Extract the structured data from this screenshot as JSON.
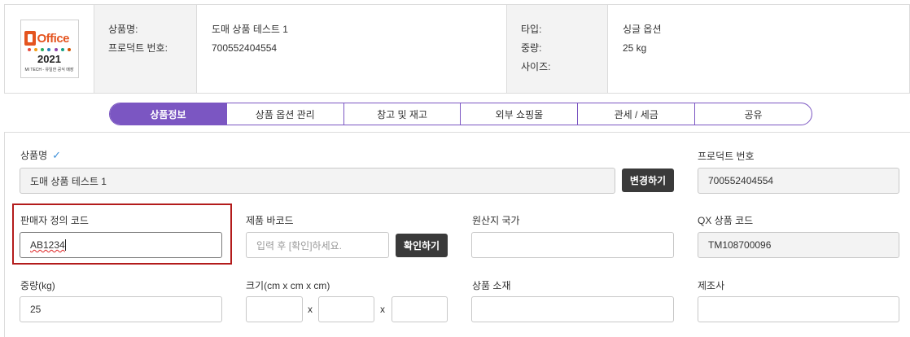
{
  "product_image": {
    "brand": "Office",
    "year": "2021",
    "caption": "MI TECH - 유일한 공식 매장",
    "dot_colors": [
      "#e74c3c",
      "#f39c12",
      "#27ae60",
      "#2980b9",
      "#8e44ad",
      "#16a085",
      "#d35400"
    ]
  },
  "summary": {
    "labels_left": [
      "상품명:",
      "프로덕트 번호:"
    ],
    "values_left": [
      "도매 상품 테스트 1",
      "700552404554"
    ],
    "labels_right": [
      "타입:",
      "중량:",
      "사이즈:"
    ],
    "values_right": [
      "싱글 옵션",
      "25 kg",
      ""
    ]
  },
  "tabs": [
    {
      "label": "상품정보",
      "active": true
    },
    {
      "label": "상품 옵션 관리",
      "active": false
    },
    {
      "label": "창고 및 재고",
      "active": false
    },
    {
      "label": "외부 쇼핑몰",
      "active": false
    },
    {
      "label": "관세 / 세금",
      "active": false
    },
    {
      "label": "공유",
      "active": false
    }
  ],
  "form": {
    "product_name": {
      "label": "상품명",
      "value": "도매 상품 테스트 1",
      "button": "변경하기"
    },
    "product_number": {
      "label": "프로덕트 번호",
      "value": "700552404554"
    },
    "seller_code": {
      "label": "판매자 정의 코드",
      "value": "AB1234"
    },
    "barcode": {
      "label": "제품 바코드",
      "placeholder": "입력 후 [확인]하세요.",
      "button": "확인하기"
    },
    "origin": {
      "label": "원산지 국가",
      "value": ""
    },
    "qx_code": {
      "label": "QX 상품 코드",
      "value": "TM108700096"
    },
    "weight": {
      "label": "중량(kg)",
      "value": "25"
    },
    "size": {
      "label": "크기(cm x cm x cm)",
      "separator": "x"
    },
    "material": {
      "label": "상품 소재",
      "value": ""
    },
    "manufacturer": {
      "label": "제조사",
      "value": ""
    }
  },
  "colors": {
    "accent": "#7b56c2",
    "highlight": "#b31b1b",
    "check": "#3d8fd8"
  }
}
